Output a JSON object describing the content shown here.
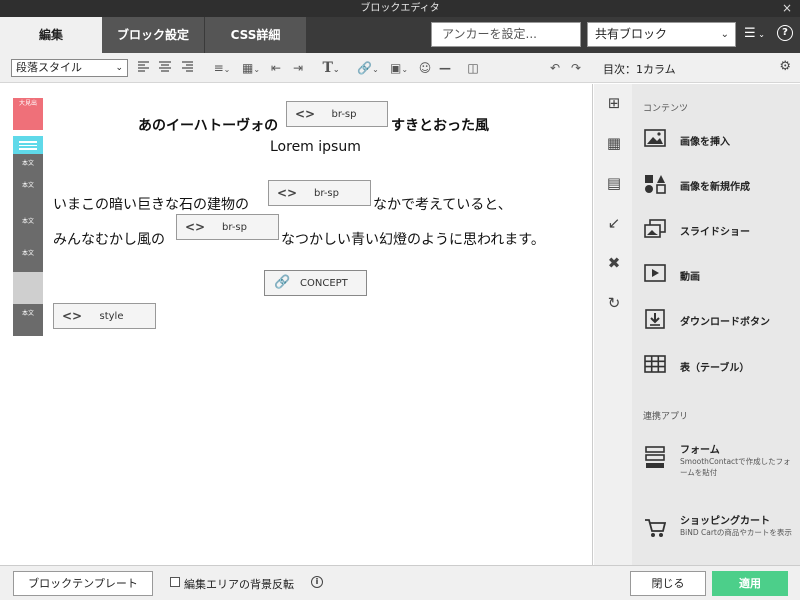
{
  "window": {
    "title": "ブロックエディタ",
    "close_glyph": "×"
  },
  "tabs": [
    {
      "label": "編集",
      "active": true
    },
    {
      "label": "ブロック設定",
      "active": false
    },
    {
      "label": "CSS詳細",
      "active": false
    }
  ],
  "anchor": {
    "placeholder": "アンカーを設定..."
  },
  "shared_block": {
    "value": "共有ブロック"
  },
  "toolbar": {
    "paragraph_style": "段落スタイル",
    "icons": [
      "align-left-icon",
      "align-center-icon",
      "align-right-icon",
      "bullet-list-icon",
      "block-list-icon",
      "outdent-icon",
      "indent-icon",
      "text-format-icon",
      "link-icon",
      "image-icon",
      "emoji-icon",
      "horizontal-rule-icon",
      "column-icon",
      "undo-icon",
      "redo-icon"
    ]
  },
  "canvas": {
    "markers": [
      "大見出",
      "",
      "本文",
      "本文",
      "本文",
      "本文",
      "",
      "本文"
    ],
    "heading_left": "あのイーハトーヴォの",
    "heading_right": "すきとおった風",
    "subheading": "Lorem ipsum",
    "line1_left": "いまこの暗い巨きな石の建物の",
    "line1_right": "なかで考えていると、",
    "line2_left": "みんなむかし風の",
    "line2_right": "なつかしい青い幻燈のように思われます。",
    "tag_brsp": "br-sp",
    "tag_style": "style",
    "concept": "CONCEPT",
    "code_glyph": "<>"
  },
  "panel": {
    "title": "目次：1カラム",
    "contents_header": "コンテンツ",
    "items": [
      {
        "label": "画像を挿入",
        "icon": "image-insert-icon"
      },
      {
        "label": "画像を新規作成",
        "icon": "shapes-icon"
      },
      {
        "label": "スライドショー",
        "icon": "slideshow-icon"
      },
      {
        "label": "動画",
        "icon": "video-icon"
      },
      {
        "label": "ダウンロードボタン",
        "icon": "download-icon"
      },
      {
        "label": "表（テーブル）",
        "icon": "table-icon"
      }
    ],
    "apps_header": "連携アプリ",
    "apps": [
      {
        "label": "フォーム",
        "desc": "SmoothContactで作成したフォームを貼付",
        "icon": "form-icon"
      },
      {
        "label": "ショッピングカート",
        "desc": "BiND Cartの商品やカートを表示",
        "icon": "cart-icon"
      }
    ]
  },
  "footer": {
    "template_button": "ブロックテンプレート",
    "invert_label": "編集エリアの背景反転",
    "close_button": "閉じる",
    "apply_button": "適用"
  },
  "colors": {
    "accent": "#4ccf8a",
    "marker_red": "#ef7079",
    "marker_cyan": "#5fd9e9",
    "marker_gray": "#6b6b6b"
  }
}
